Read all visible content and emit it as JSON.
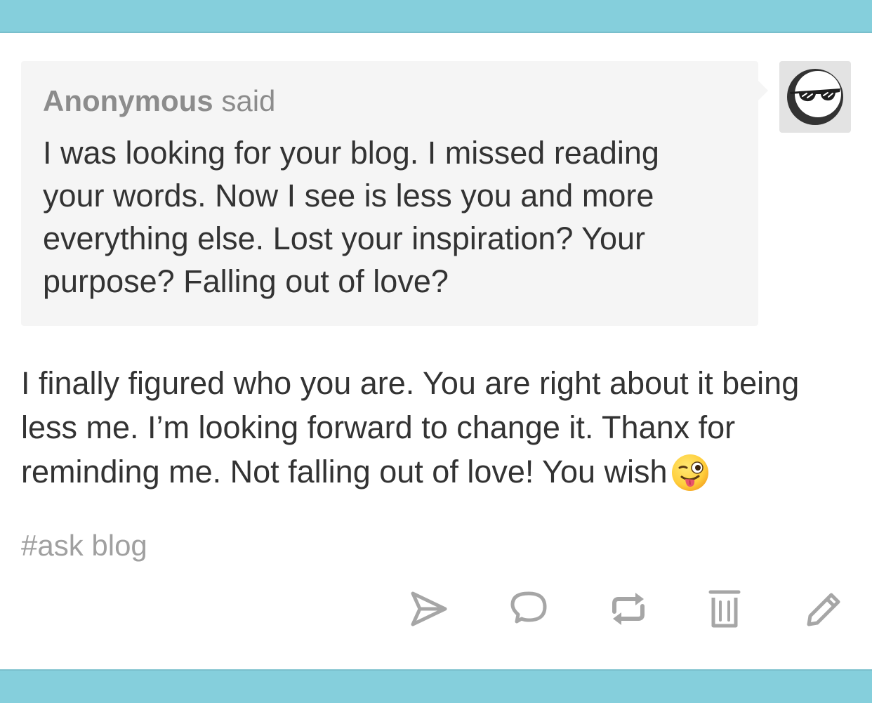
{
  "ask": {
    "asker_name": "Anonymous",
    "said_label": "said",
    "question": "I was looking for your blog. I missed reading your words. Now I see is less you and more everything else. Lost your inspiration? Your purpose? Falling out of love?"
  },
  "answer": {
    "text": "I finally figured who you are. You are right about it being less me. I’m looking forward to change it. Thanx for reminding me. Not falling out of love! You wish",
    "emoji": "winking-face-with-tongue"
  },
  "tags": [
    "#ask blog"
  ],
  "controls": [
    "share-icon",
    "reply-icon",
    "reblog-icon",
    "delete-icon",
    "edit-icon"
  ],
  "colors": {
    "bar": "#85cfdc",
    "bubble": "#f5f5f5",
    "text": "#333333",
    "muted": "#8c8c8c",
    "icon": "#a6a6a6"
  }
}
